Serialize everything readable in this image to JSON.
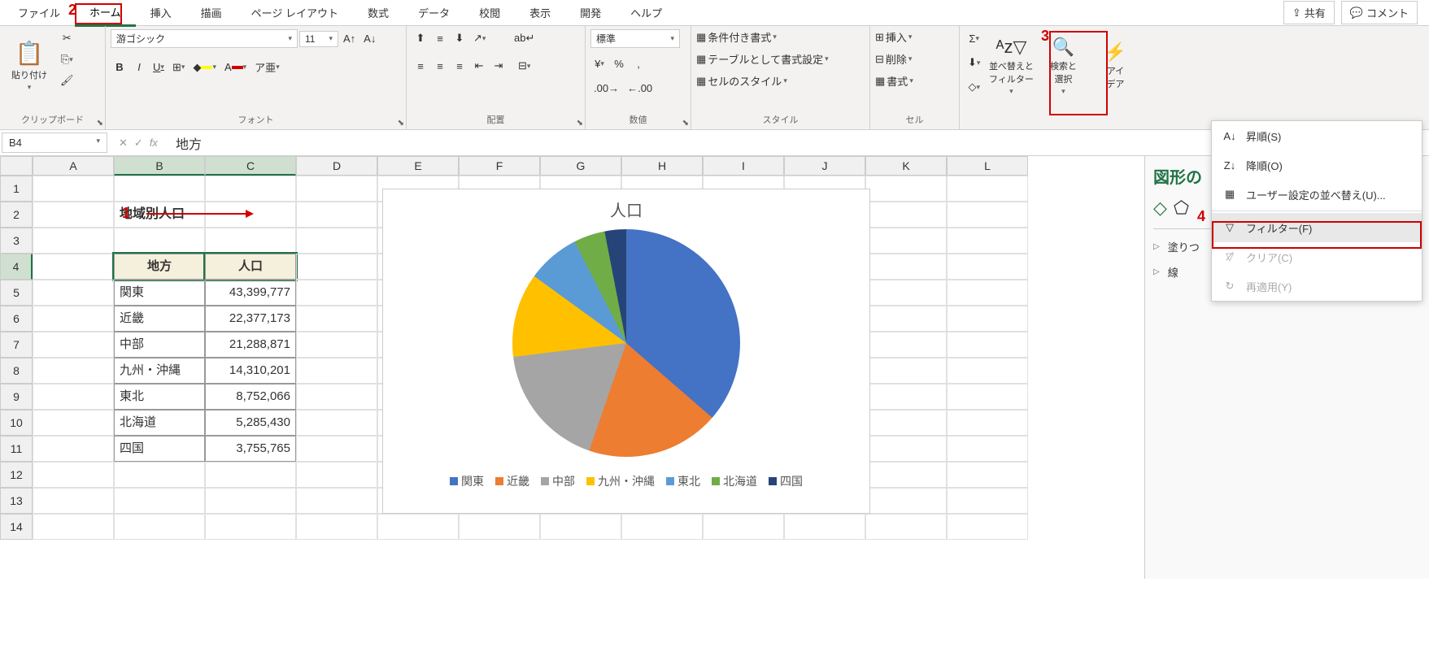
{
  "tabs": {
    "file": "ファイル",
    "home": "ホーム",
    "insert": "挿入",
    "draw": "描画",
    "layout": "ページ レイアウト",
    "formulas": "数式",
    "data": "データ",
    "review": "校閲",
    "view": "表示",
    "developer": "開発",
    "help": "ヘルプ",
    "share": "共有",
    "comment": "コメント"
  },
  "ribbon": {
    "clipboard": {
      "paste": "貼り付け",
      "label": "クリップボード"
    },
    "font": {
      "name": "游ゴシック",
      "size": "11",
      "label": "フォント"
    },
    "alignment": {
      "label": "配置"
    },
    "number": {
      "format": "標準",
      "label": "数値"
    },
    "styles": {
      "cond": "条件付き書式",
      "table": "テーブルとして書式設定",
      "cell": "セルのスタイル",
      "label": "スタイル"
    },
    "cells": {
      "insert": "挿入",
      "delete": "削除",
      "format": "書式",
      "label": "セル"
    },
    "editing": {
      "sort": "並べ替えと\nフィルター",
      "find": "検索と\n選択",
      "ideas": "アイ\nデア"
    }
  },
  "formula_bar": {
    "name_box": "B4",
    "value": "地方"
  },
  "columns": [
    "A",
    "B",
    "C",
    "D",
    "E",
    "F",
    "G",
    "H",
    "I",
    "J",
    "K",
    "L"
  ],
  "rows": [
    "1",
    "2",
    "3",
    "4",
    "5",
    "6",
    "7",
    "8",
    "9",
    "10",
    "11",
    "12",
    "13",
    "14"
  ],
  "sheet": {
    "title": "地域別人口",
    "header_region": "地方",
    "header_pop": "人口",
    "data": [
      {
        "region": "関東",
        "pop": "43,399,777"
      },
      {
        "region": "近畿",
        "pop": "22,377,173"
      },
      {
        "region": "中部",
        "pop": "21,288,871"
      },
      {
        "region": "九州・沖縄",
        "pop": "14,310,201"
      },
      {
        "region": "東北",
        "pop": "8,752,066"
      },
      {
        "region": "北海道",
        "pop": "5,285,430"
      },
      {
        "region": "四国",
        "pop": "3,755,765"
      }
    ]
  },
  "chart_data": {
    "type": "pie",
    "title": "人口",
    "categories": [
      "関東",
      "近畿",
      "中部",
      "九州・沖縄",
      "東北",
      "北海道",
      "四国"
    ],
    "values": [
      43399777,
      22377173,
      21288871,
      14310201,
      8752066,
      5285430,
      3755765
    ],
    "colors": [
      "#4472C4",
      "#ED7D31",
      "#A5A5A5",
      "#FFC000",
      "#5B9BD5",
      "#70AD47",
      "#264478"
    ]
  },
  "side_pane": {
    "title": "図形の",
    "fill": "塗りつ",
    "line": "線"
  },
  "dropdown": {
    "asc": "昇順(S)",
    "desc": "降順(O)",
    "custom": "ユーザー設定の並べ替え(U)...",
    "filter": "フィルター(F)",
    "clear": "クリア(C)",
    "reapply": "再適用(Y)"
  },
  "annotations": {
    "n1": "1",
    "n2": "2",
    "n3": "3",
    "n4": "4"
  }
}
